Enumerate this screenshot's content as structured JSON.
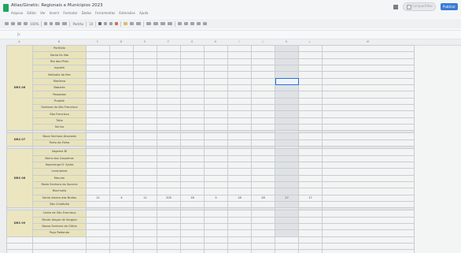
{
  "window": {
    "title": "Atlas/Ginetic: Regionais e Municipios 2023",
    "share_label": "Compartilhar",
    "primary_button": "Publicar"
  },
  "menu": [
    "Arquivo",
    "Editar",
    "Ver",
    "Inserir",
    "Formatar",
    "Dados",
    "Ferramentas",
    "Extensões",
    "Ajuda"
  ],
  "toolbar": {
    "zoom": "100%",
    "font": "Padrão",
    "font_size": "10"
  },
  "formula_bar": {
    "value": ""
  },
  "columns": [
    "A",
    "B",
    "C",
    "D",
    "E",
    "F",
    "G",
    "H",
    "I",
    "J",
    "K",
    "L",
    "M"
  ],
  "groups": [
    {
      "code": "DRS 06",
      "rows": [
        "Portfolio",
        "Santa Ila Ildo",
        "Rio dos Pires",
        "Ingratti",
        "Nellvalla do Rev",
        "Marilena",
        "Babarta",
        "Passados",
        "Prapisk",
        "Santana do São Francisco",
        "São Francisco",
        "Tutia",
        "Serino"
      ]
    },
    {
      "code": "DRS 07",
      "rows": [
        "Nova Senhora Alvorada",
        "Porto da Folha"
      ]
    },
    {
      "code": "DRS 08",
      "rows": [
        "Ilagema Bi",
        "Barra dos Coqueiros",
        "Itaporanga D' Ajuda",
        "Laranjeiras",
        "Maruim",
        "Rosia Senhora do Socorro",
        "Riachuelo",
        "Santo Amaro das Brotas",
        "São Cristóvão"
      ]
    },
    {
      "code": "DRS 09",
      "rows": [
        "Cedro de São Francisco",
        "Monte Alegre de Sergipe",
        "Nossa Senhora da Glória",
        "Poço Redondo"
      ]
    }
  ],
  "highlight_row": {
    "name": "Santo Amaro das Brotas",
    "values": [
      "11",
      "4",
      "11",
      "205",
      "18",
      "5",
      "18",
      "28",
      "17",
      "17"
    ]
  }
}
